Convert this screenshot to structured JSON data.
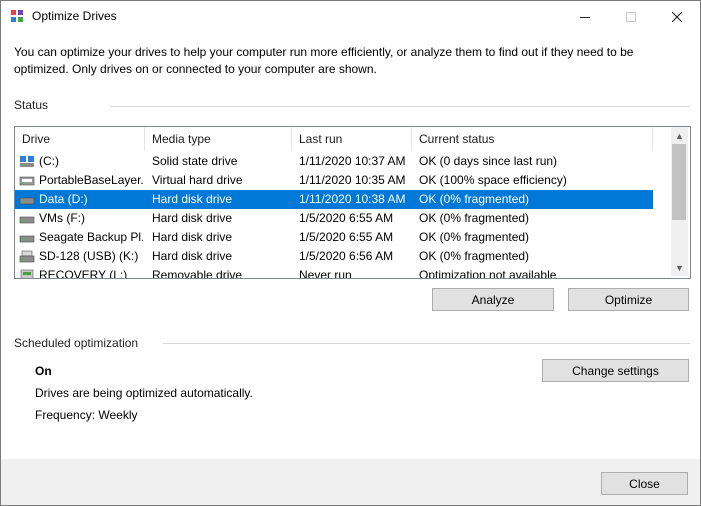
{
  "window": {
    "title": "Optimize Drives"
  },
  "intro": "You can optimize your drives to help your computer run more efficiently, or analyze them to find out if they need to be optimized. Only drives on or connected to your computer are shown.",
  "status": {
    "label": "Status",
    "columns": [
      "Drive",
      "Media type",
      "Last run",
      "Current status"
    ],
    "rows": [
      {
        "drive": "(C:)",
        "media": "Solid state drive",
        "last_run": "1/11/2020 10:37 AM",
        "status": "OK (0 days since last run)",
        "icon": "ssd-drive-icon"
      },
      {
        "drive": "PortableBaseLayer...",
        "media": "Virtual hard drive",
        "last_run": "1/11/2020 10:35 AM",
        "status": "OK (100% space efficiency)",
        "icon": "virtual-drive-icon"
      },
      {
        "drive": "Data (D:)",
        "media": "Hard disk drive",
        "last_run": "1/11/2020 10:38 AM",
        "status": "OK (0% fragmented)",
        "icon": "hard-drive-icon",
        "selected": true
      },
      {
        "drive": "VMs (F:)",
        "media": "Hard disk drive",
        "last_run": "1/5/2020 6:55 AM",
        "status": "OK (0% fragmented)",
        "icon": "hard-drive-icon"
      },
      {
        "drive": "Seagate Backup Pl...",
        "media": "Hard disk drive",
        "last_run": "1/5/2020 6:55 AM",
        "status": "OK (0% fragmented)",
        "icon": "hard-drive-icon"
      },
      {
        "drive": "SD-128 (USB) (K:)",
        "media": "Hard disk drive",
        "last_run": "1/5/2020 6:56 AM",
        "status": "OK (0% fragmented)",
        "icon": "usb-drive-icon"
      },
      {
        "drive": "RECOVERY (L:)",
        "media": "Removable drive",
        "last_run": "Never run",
        "status": "Optimization not available",
        "icon": "removable-drive-icon"
      }
    ]
  },
  "buttons": {
    "analyze": "Analyze",
    "optimize": "Optimize",
    "change_settings": "Change settings",
    "close": "Close"
  },
  "scheduled": {
    "label": "Scheduled optimization",
    "state": "On",
    "description": "Drives are being optimized automatically.",
    "frequency": "Frequency: Weekly"
  },
  "colors": {
    "selection": "#0078d7",
    "button_face": "#e1e1e1",
    "footer": "#f0f0f0"
  }
}
